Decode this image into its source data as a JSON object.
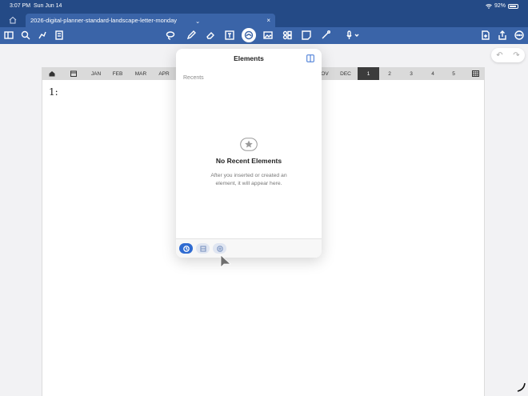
{
  "status": {
    "time": "3:07 PM",
    "date": "Sun Jun 14",
    "battery": "92%",
    "battery_level": 0.92
  },
  "tab": {
    "title": "2026-digital-planner-standard-landscape-letter-monday"
  },
  "toolbar": {
    "left_icons": [
      "sidebar-icon",
      "search-icon",
      "bookmark-share-icon",
      "document-icon"
    ],
    "center_icons": [
      "lasso-icon",
      "pen-icon",
      "eraser-icon",
      "text-box-icon",
      "elements-icon",
      "image-icon",
      "shapes-icon",
      "sticky-note-icon",
      "laser-icon",
      "mic-icon"
    ],
    "right_icons": [
      "add-page-icon",
      "share-icon",
      "more-icon"
    ]
  },
  "nav": {
    "months": [
      "JAN",
      "FEB",
      "MAR",
      "APR",
      "OV",
      "DEC"
    ],
    "weeks": [
      "1",
      "2",
      "3",
      "4",
      "5"
    ],
    "selected_week": "1"
  },
  "page": {
    "day_label": "1:"
  },
  "popover": {
    "title": "Elements",
    "section": "Recents",
    "empty_title": "No Recent Elements",
    "empty_desc": "After you inserted or created an element, it will appear here."
  }
}
